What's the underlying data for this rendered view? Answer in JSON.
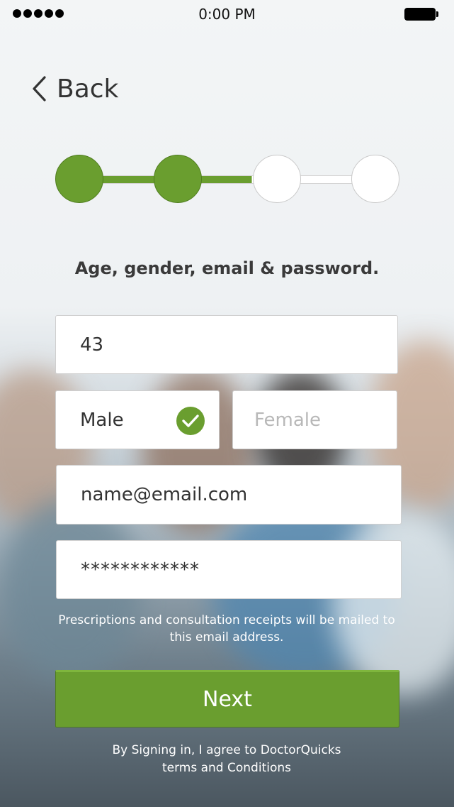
{
  "status_bar": {
    "time": "0:00 PM"
  },
  "nav": {
    "back_label": "Back"
  },
  "stepper": {
    "total_steps": 4,
    "completed_steps": 2,
    "connector_progress": 0.5
  },
  "form": {
    "subtitle": "Age, gender, email & password.",
    "age_value": "43",
    "gender": {
      "male_label": "Male",
      "female_label": "Female",
      "selected": "Male"
    },
    "email_value": "name@email.com",
    "password_value": "************"
  },
  "email_note": "Prescriptions and consultation receipts will be mailed to this email address.",
  "next_label": "Next",
  "terms": {
    "line1": "By Signing in, I agree to DoctorQuicks",
    "line2": "terms and Conditions"
  },
  "colors": {
    "accent": "#6a9e2f",
    "accent_border": "#4f7d1f",
    "todo_track": "#ffffff"
  },
  "icons": {
    "back": "chevron-left-icon",
    "selected": "check-circle-icon",
    "signal": "signal-dots-icon",
    "battery": "battery-icon"
  }
}
